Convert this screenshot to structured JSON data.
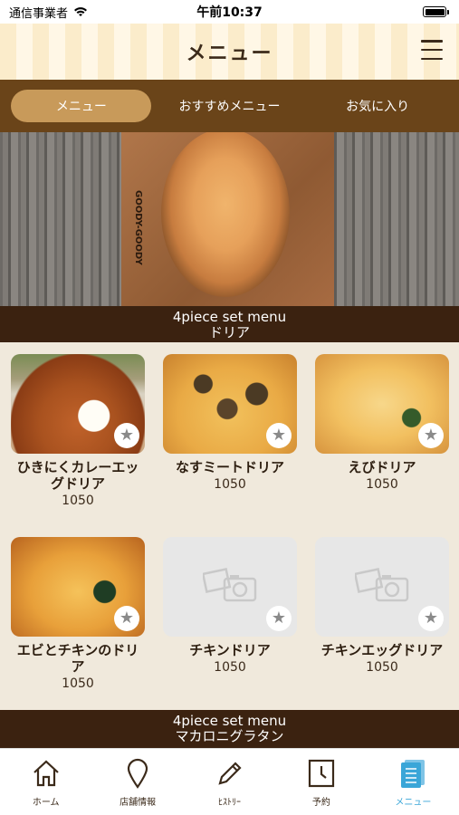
{
  "status_bar": {
    "carrier": "通信事業者",
    "time": "午前10:37"
  },
  "header": {
    "title": "メニュー"
  },
  "tabs": [
    {
      "label": "メニュー"
    },
    {
      "label": "おすすめメニュー"
    },
    {
      "label": "お気に入り"
    }
  ],
  "hero": {
    "board_text": "GOODY-GOODY",
    "caption_en": "4piece set menu",
    "caption_ja": "ドリア"
  },
  "items": [
    {
      "name": "ひきにくカレーエッグドリア",
      "price": "1050"
    },
    {
      "name": "なすミートドリア",
      "price": "1050"
    },
    {
      "name": "えびドリア",
      "price": "1050"
    },
    {
      "name": "エビとチキンのドリア",
      "price": "1050"
    },
    {
      "name": "チキンドリア",
      "price": "1050"
    },
    {
      "name": "チキンエッグドリア",
      "price": "1050"
    }
  ],
  "section2": {
    "caption_en": "4piece set menu",
    "caption_ja": "マカロニグラタン"
  },
  "tabbar": [
    {
      "label": "ホーム",
      "icon": "home-icon"
    },
    {
      "label": "店舗情報",
      "icon": "location-pin-icon"
    },
    {
      "label": "ﾋｽﾄﾘｰ",
      "icon": "pencil-icon"
    },
    {
      "label": "予約",
      "icon": "clock-icon"
    },
    {
      "label": "メニュー",
      "icon": "menu-book-icon"
    }
  ],
  "colors": {
    "accent": "#3aa6d8",
    "tab_bg": "#6a4419",
    "tab_active": "#c89a5a",
    "caption_bg": "#3b2210"
  }
}
